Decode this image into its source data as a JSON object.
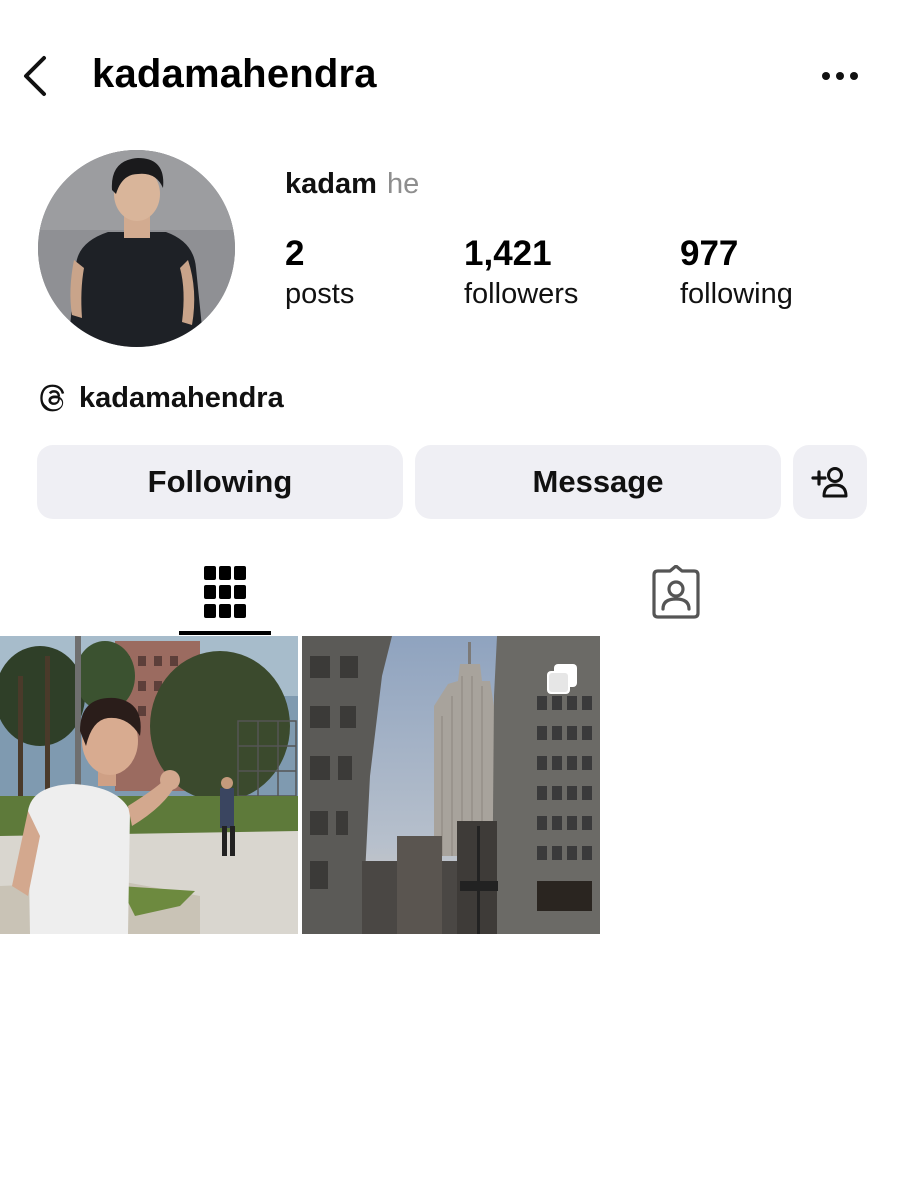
{
  "header": {
    "username": "kadamahendra"
  },
  "profile": {
    "display_name": "kadam",
    "pronouns": "he",
    "stats": [
      {
        "value": "2",
        "label": "posts"
      },
      {
        "value": "1,421",
        "label": "followers"
      },
      {
        "value": "977",
        "label": "following"
      }
    ],
    "threads_handle": "kadamahendra"
  },
  "actions": {
    "following_label": "Following",
    "message_label": "Message"
  },
  "tabs": [
    {
      "icon": "grid-icon",
      "active": true
    },
    {
      "icon": "tagged-icon",
      "active": false
    }
  ],
  "posts": [
    {
      "kind": "photo",
      "multi": false
    },
    {
      "kind": "photo",
      "multi": true
    }
  ],
  "colors": {
    "button_bg": "#efeff4",
    "secondary_text": "#8e8e8e",
    "text": "#000000",
    "background": "#ffffff"
  }
}
